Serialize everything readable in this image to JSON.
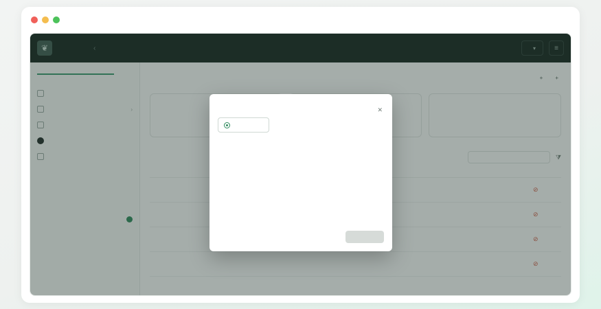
{
  "app": {
    "brand_name": "",
    "brand_sub": "",
    "org_label": "",
    "logo_icon": "leaf-icon",
    "collapse_icon": "chevron-left-icon",
    "menu_icon": "menu-icon"
  },
  "sidebar": {
    "workspace_label": "",
    "workspace_switch": "",
    "workspace_name": "",
    "nav": [
      {
        "label": "",
        "icon": "home-icon"
      },
      {
        "label": "",
        "icon": "folder-icon"
      },
      {
        "label": "",
        "icon": "grid-icon"
      },
      {
        "label": "",
        "icon": "circle-icon",
        "active": true
      },
      {
        "label": "",
        "icon": "settings-icon"
      }
    ],
    "section_title": "",
    "section_items": [
      {
        "label": ""
      },
      {
        "label": ""
      },
      {
        "label": "",
        "badge_color": "#2e8a5c"
      },
      {
        "label": ""
      }
    ]
  },
  "page": {
    "title": "",
    "description": "",
    "action_1": "",
    "action_2": ""
  },
  "stats": [
    {
      "label": "",
      "value": "",
      "foot_left": "",
      "foot_right": ""
    },
    {
      "label": "",
      "value": "",
      "foot_left": "",
      "foot_right": ""
    },
    {
      "label": "",
      "value": "",
      "foot_left": "",
      "foot_right": ""
    }
  ],
  "table": {
    "title": "",
    "search_placeholder": "",
    "columns": [
      "",
      "",
      "",
      "",
      "",
      ""
    ],
    "rows": [
      [
        "",
        "",
        "",
        "",
        "",
        ""
      ],
      [
        "",
        "",
        "",
        "",
        "",
        ""
      ],
      [
        "",
        "",
        "",
        "",
        "",
        ""
      ],
      [
        "",
        "",
        "",
        "",
        "",
        ""
      ]
    ]
  },
  "modal": {
    "title": "",
    "description": "",
    "select_label": "",
    "options": [
      "",
      "",
      ""
    ],
    "drop_main": "",
    "drop_sub": "",
    "note": "",
    "cancel": "",
    "submit": ""
  },
  "colors": {
    "topbar": "#13231d",
    "accent": "#2e8a5c",
    "danger": "#d05a45"
  }
}
